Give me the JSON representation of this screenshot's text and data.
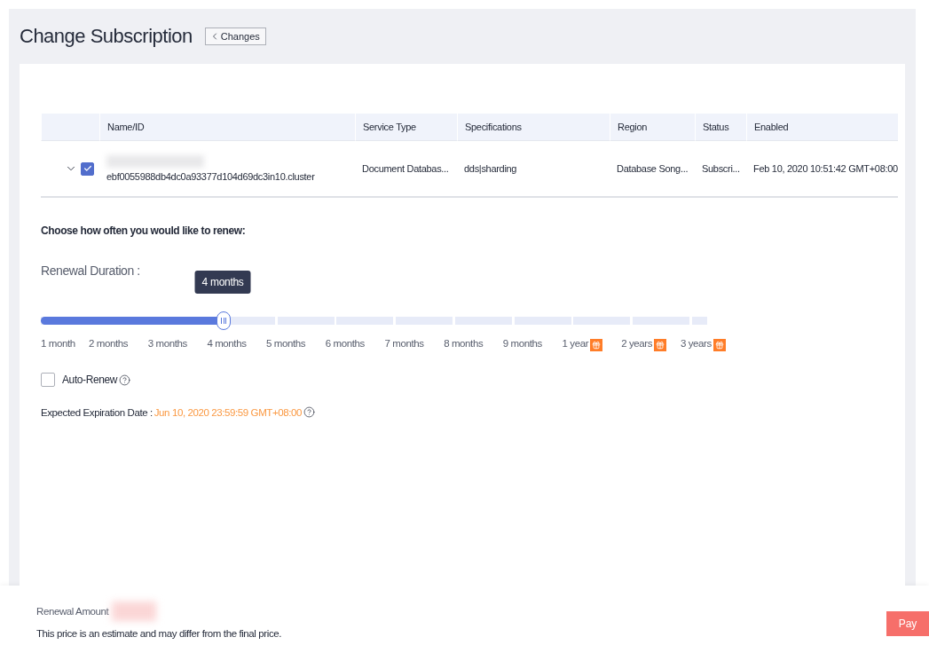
{
  "page": {
    "title": "Change Subscription",
    "back_button": "Changes"
  },
  "table": {
    "columns": [
      "Name/ID",
      "Service Type",
      "Specifications",
      "Region",
      "Status",
      "Enabled"
    ],
    "rows": [
      {
        "expanded": false,
        "checked": true,
        "id": "ebf0055988db4dc0a93377d104d69dc3in10.cluster",
        "service_type": "Document Databas...",
        "specifications": "dds|sharding",
        "region": "Database Song...",
        "status": "Subscri...",
        "enabled": "Feb 10, 2020 10:51:42 GMT+08:00"
      }
    ]
  },
  "renewal": {
    "heading": "Choose how often you would like to renew:",
    "duration_label": "Renewal Duration :",
    "tooltip": "4 months",
    "level": 0.273,
    "marks": [
      {
        "label": "1 month",
        "gift": false
      },
      {
        "label": "2 months",
        "gift": false
      },
      {
        "label": "3 months",
        "gift": false
      },
      {
        "label": "4 months",
        "gift": false
      },
      {
        "label": "5 months",
        "gift": false
      },
      {
        "label": "6 months",
        "gift": false
      },
      {
        "label": "7 months",
        "gift": false
      },
      {
        "label": "8 months",
        "gift": false
      },
      {
        "label": "9 months",
        "gift": false
      },
      {
        "label": "1 year",
        "gift": true
      },
      {
        "label": "2 years",
        "gift": true
      },
      {
        "label": "3 years",
        "gift": true
      }
    ],
    "auto_renew": {
      "label": "Auto-Renew",
      "checked": false
    },
    "expiration": {
      "label": "Expected Expiration Date :",
      "value": "Jun 10, 2020 23:59:59 GMT+08:00"
    }
  },
  "footer": {
    "amount_label": "Renewal Amount",
    "note": "This price is an estimate and may differ from the final price.",
    "pay_button": "Pay"
  }
}
